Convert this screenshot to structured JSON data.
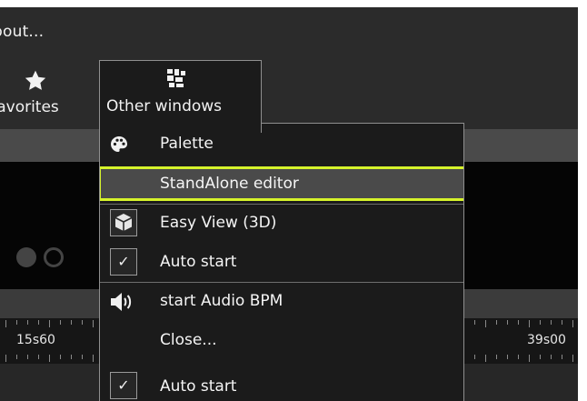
{
  "menubar": {
    "about_label": "bout..."
  },
  "toolbar": {
    "favorites_label": "Favorites",
    "other_windows_label": "Other windows"
  },
  "timeline": {
    "left_time": "15s60",
    "right_time": "39s00"
  },
  "menu": {
    "items": [
      {
        "label": "Palette",
        "icon": "palette-icon"
      },
      {
        "label": "StandAlone editor",
        "highlighted": true
      },
      {
        "label": "Easy View (3D)",
        "icon": "easy-view-3d-icon"
      },
      {
        "label": "Auto start",
        "checked": true
      },
      {
        "label": "start Audio BPM",
        "icon": "speaker-icon"
      },
      {
        "label": "Close..."
      },
      {
        "label": "Auto start",
        "checked": true
      }
    ]
  },
  "colors": {
    "highlight_border": "#d6f32b",
    "menu_bg": "#1b1b1b",
    "app_bg": "#212121"
  }
}
